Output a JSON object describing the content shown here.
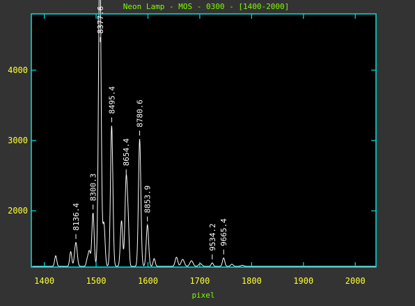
{
  "chart_data": {
    "type": "line",
    "title": "Neon Lamp - MOS - 0300 - [1400-2000]",
    "xlabel": "pixel",
    "ylabel": "",
    "xlim": [
      1375,
      2040
    ],
    "ylim": [
      1200,
      4800
    ],
    "xticks": [
      1400,
      1500,
      1600,
      1700,
      1800,
      1900,
      2000
    ],
    "yticks": [
      2000,
      3000,
      4000
    ],
    "baseline": 1210,
    "colors": {
      "background": "#333333",
      "plot_bg": "#000000",
      "frame": "#00e5e5",
      "title": "#7cfc00",
      "ticklabels": "#ffff33",
      "xlabel": "#7cfc00",
      "line": "#ffffff",
      "annotation": "#ffffff"
    },
    "peaks": [
      {
        "x": 1422,
        "y": 1360,
        "w": 2.0
      },
      {
        "x": 1451,
        "y": 1420,
        "w": 2.0
      },
      {
        "x": 1461,
        "y": 1550,
        "w": 2.5
      },
      {
        "x": 1483,
        "y": 1310,
        "w": 2.0
      },
      {
        "x": 1487,
        "y": 1420,
        "w": 2.0
      },
      {
        "x": 1494,
        "y": 1970,
        "w": 2.2
      },
      {
        "x": 1506,
        "y": 3480,
        "w": 2.2
      },
      {
        "x": 1508,
        "y": 3900,
        "w": 2.2
      },
      {
        "x": 1515,
        "y": 1820,
        "w": 2.2
      },
      {
        "x": 1530,
        "y": 3210,
        "w": 2.3
      },
      {
        "x": 1549,
        "y": 1860,
        "w": 2.2
      },
      {
        "x": 1558,
        "y": 2470,
        "w": 2.3
      },
      {
        "x": 1562,
        "y": 1700,
        "w": 1.8
      },
      {
        "x": 1584,
        "y": 3020,
        "w": 2.3
      },
      {
        "x": 1599,
        "y": 1800,
        "w": 2.3
      },
      {
        "x": 1612,
        "y": 1320,
        "w": 2.0
      },
      {
        "x": 1655,
        "y": 1340,
        "w": 2.5
      },
      {
        "x": 1667,
        "y": 1310,
        "w": 3.0
      },
      {
        "x": 1684,
        "y": 1290,
        "w": 3.0
      },
      {
        "x": 1701,
        "y": 1250,
        "w": 3.0
      },
      {
        "x": 1724,
        "y": 1260,
        "w": 2.0
      },
      {
        "x": 1746,
        "y": 1330,
        "w": 2.2
      },
      {
        "x": 1762,
        "y": 1240,
        "w": 2.5
      },
      {
        "x": 1782,
        "y": 1225,
        "w": 3.0
      }
    ],
    "annotations": [
      {
        "label": "8136.4",
        "x": 1461,
        "y": 1550
      },
      {
        "label": "8300.3",
        "x": 1494,
        "y": 1970
      },
      {
        "label": "8377.6",
        "x": 1508,
        "y": 4350
      },
      {
        "label": "8495.4",
        "x": 1530,
        "y": 3210
      },
      {
        "label": "8654.4",
        "x": 1558,
        "y": 2470
      },
      {
        "label": "8780.6",
        "x": 1584,
        "y": 3020
      },
      {
        "label": "8853.9",
        "x": 1599,
        "y": 1800
      },
      {
        "label": "9534.2",
        "x": 1724,
        "y": 1260
      },
      {
        "label": "9665.4",
        "x": 1746,
        "y": 1330
      }
    ]
  }
}
